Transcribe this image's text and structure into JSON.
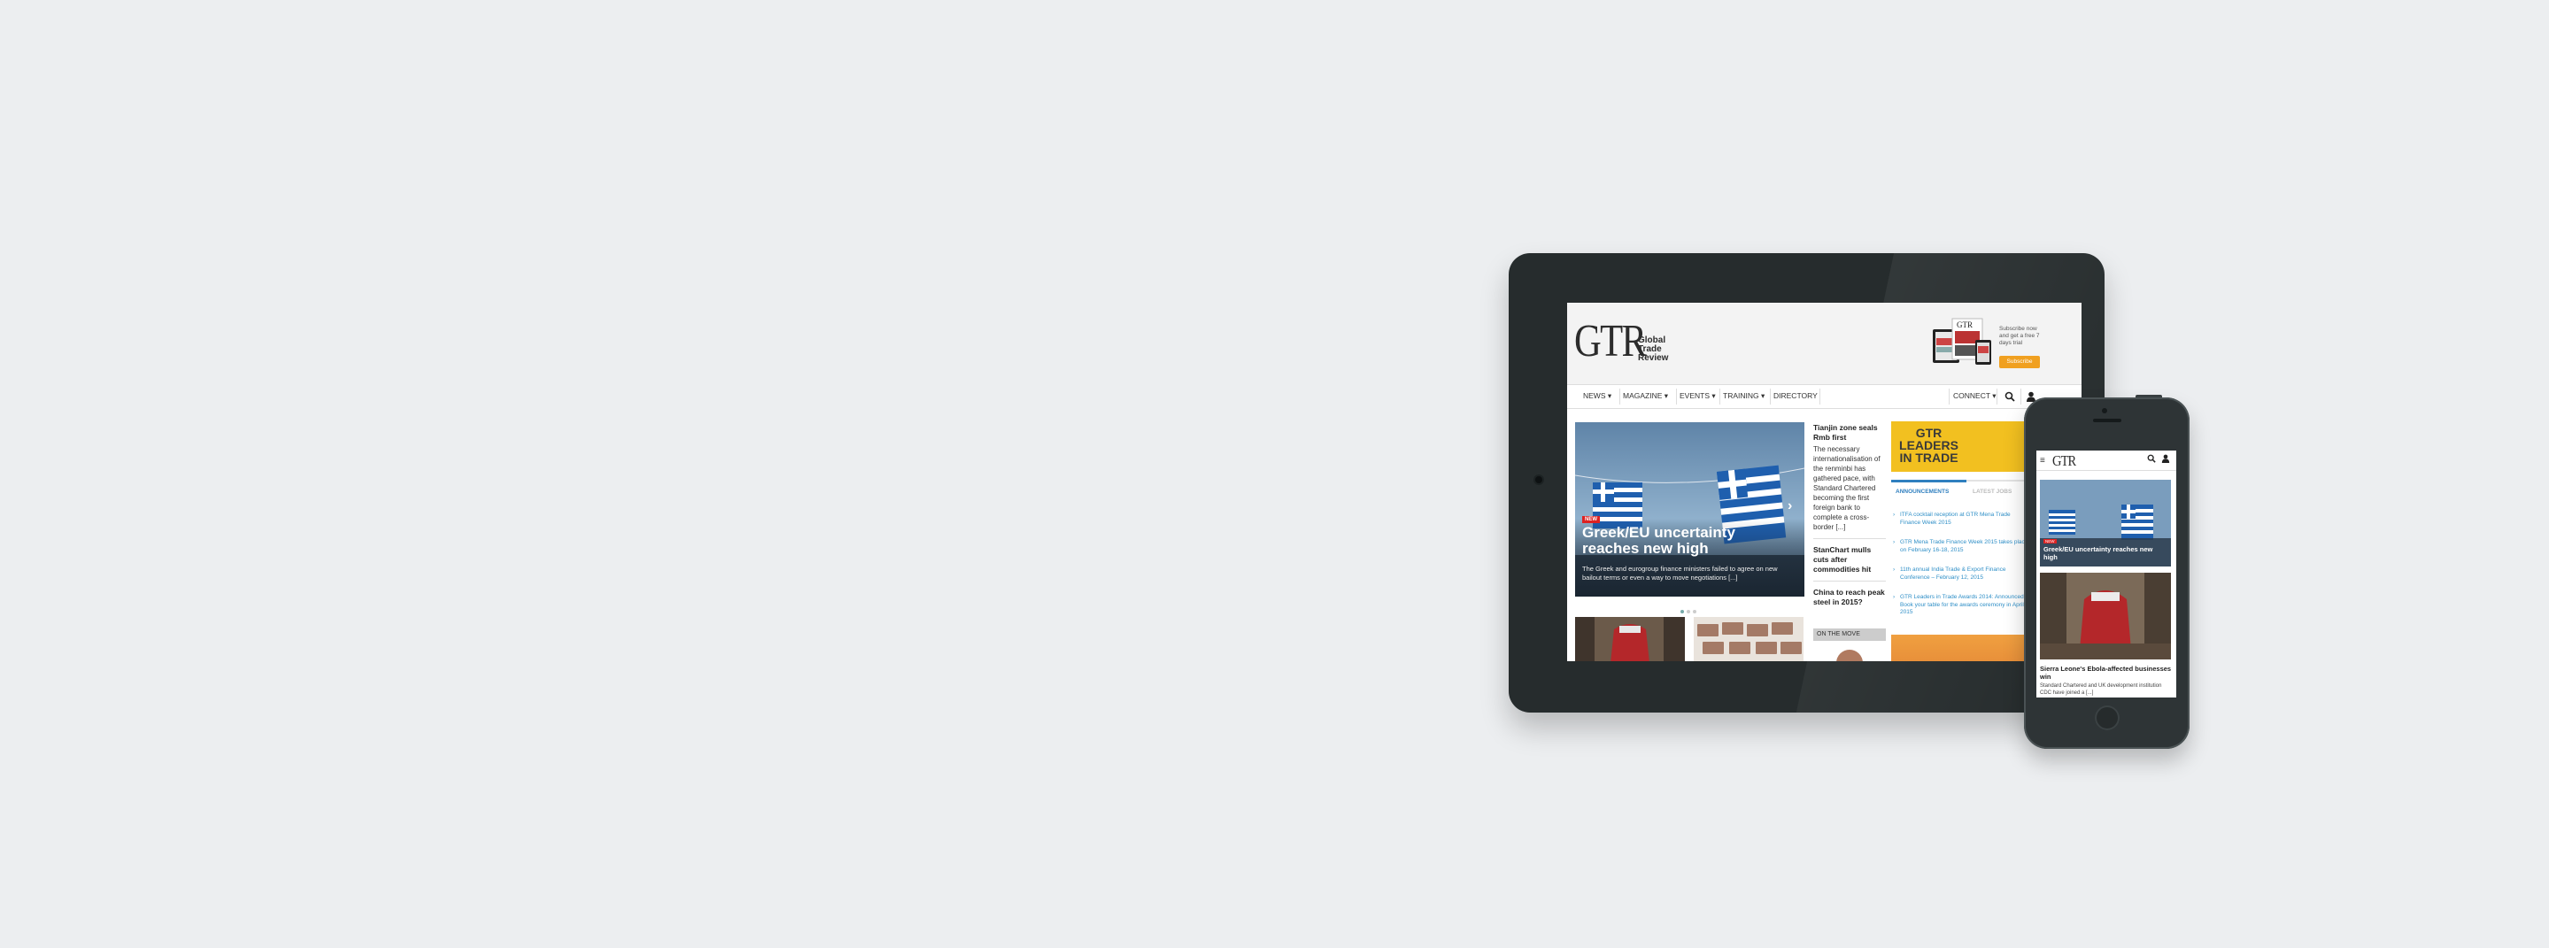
{
  "tablet_site": {
    "logo": "GTR",
    "logo_name": [
      "Global",
      "Trade",
      "Review"
    ],
    "promo": {
      "text": "Subscribe now and get a free 7 days trial",
      "button": "Subscribe",
      "device_logo": "GTR"
    },
    "nav": {
      "items": [
        "NEWS ▾",
        "MAGAZINE ▾",
        "EVENTS ▾",
        "TRAINING ▾",
        "DIRECTORY"
      ],
      "connect": "CONNECT ▾",
      "search_icon": "search-icon",
      "user_icon": "user-icon"
    },
    "hero": {
      "tag": "NEW",
      "title": "Greek/EU uncertainty reaches new high",
      "summary": "The Greek and eurogroup finance ministers failed to agree on new bailout terms or even a way to move negotiations [...]",
      "next_icon": "chevron-right-icon"
    },
    "stories": [
      {
        "title": "Tianjin zone seals Rmb first",
        "body": "The necessary internationalisation of the renminbi has gathered pace, with Standard Chartered becoming the first foreign bank to complete a cross-border [...]"
      },
      {
        "title": "StanChart mulls cuts after commodities hit",
        "body": ""
      },
      {
        "title": "China to reach peak steel in 2015?",
        "body": ""
      }
    ],
    "on_the_move": "ON THE MOVE",
    "leaders_ad": [
      "GTR",
      "LEADERS",
      "IN TRADE"
    ],
    "tabs": {
      "active": "ANNOUNCEMENTS",
      "inactive": "LATEST JOBS"
    },
    "announcements": [
      "ITFA cocktail reception at GTR Mena Trade Finance Week 2015",
      "GTR Mena Trade Finance Week 2015 takes place on February 16-18, 2015",
      "11th annual India Trade & Export Finance Conference – February 12, 2015",
      "GTR Leaders in Trade Awards 2014: Announced! Book your table for the awards ceremony in April 2015"
    ]
  },
  "phone_site": {
    "logo": "GTR",
    "menu_icon": "hamburger-menu-icon",
    "search_icon": "search-icon",
    "user_icon": "user-icon",
    "hero": {
      "tag": "NEW",
      "title": "Greek/EU uncertainty reaches new high"
    },
    "story": {
      "title": "Sierra Leone's Ebola-affected businesses win",
      "body": "Standard Chartered and UK development institution CDC have joined a [...]"
    }
  },
  "colors": {
    "background": "#eceef0",
    "device_frame": "#262c2d",
    "accent_orange": "#f0a020",
    "leaders_yellow": "#f2c020",
    "link_blue": "#2f8fc7"
  }
}
